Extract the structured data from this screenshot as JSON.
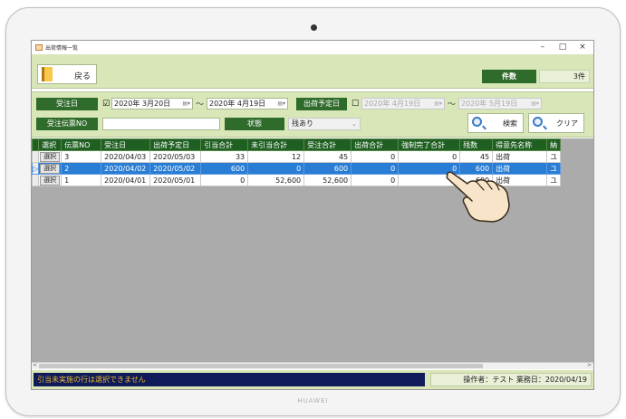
{
  "device": {
    "brand": "HUAWEI"
  },
  "window": {
    "title": "出荷情報一覧",
    "minimize": "–",
    "maximize": "□",
    "close": "×"
  },
  "toolbar": {
    "back_label": "戻る",
    "count_label": "件数",
    "count_value": "3件"
  },
  "filters": {
    "order_date_label": "受注日",
    "order_date_checked": "☑",
    "order_date_from": "2020年  3月20日",
    "order_date_to": "2020年  4月19日",
    "ship_date_label": "出荷予定日",
    "ship_date_checked": "☐",
    "ship_date_from": "2020年  4月19日",
    "ship_date_to": "2020年  5月19日",
    "tilde": "〜",
    "date_dropdown": "▤▾",
    "order_slip_label": "受注伝票NO",
    "order_slip_value": "",
    "status_label": "状態",
    "status_value": "残あり",
    "status_arrow": "⌄",
    "search_label": "検索",
    "clear_label": "クリア"
  },
  "grid": {
    "columns": [
      "選択",
      "伝票NO",
      "受注日",
      "出荷予定日",
      "引当合計",
      "未引当合計",
      "受注合計",
      "出荷合計",
      "強制完了合計",
      "残数",
      "得意先名称",
      "納"
    ],
    "current_row_marker": "▷",
    "select_label": "選択",
    "rows": [
      {
        "slip_no": "3",
        "order_date": "2020/04/03",
        "ship_date": "2020/05/03",
        "allocated": "33",
        "unallocated": "12",
        "ordered": "45",
        "shipped": "0",
        "forced": "0",
        "remaining": "45",
        "customer": "出荷",
        "extra": "ユ"
      },
      {
        "slip_no": "2",
        "order_date": "2020/04/02",
        "ship_date": "2020/05/02",
        "allocated": "600",
        "unallocated": "0",
        "ordered": "600",
        "shipped": "0",
        "forced": "0",
        "remaining": "600",
        "customer": "出荷",
        "extra": "ユ"
      },
      {
        "slip_no": "1",
        "order_date": "2020/04/01",
        "ship_date": "2020/05/01",
        "allocated": "0",
        "unallocated": "52,600",
        "ordered": "52,600",
        "shipped": "0",
        "forced": "",
        "remaining": "600",
        "customer": "出荷",
        "extra": "ユ"
      }
    ],
    "selected_row_index": 1
  },
  "scrollbar": {
    "left_arrow": "<",
    "right_arrow": ">"
  },
  "status": {
    "message": "引当未実施の行は選択できません",
    "info": "操作者：テスト  業務日：2020/04/19"
  },
  "colors": {
    "header_green": "#1f5f22",
    "panel_green": "#d8e6b8",
    "selection_blue": "#2a7dd4",
    "status_navy": "#0e1a5a"
  }
}
